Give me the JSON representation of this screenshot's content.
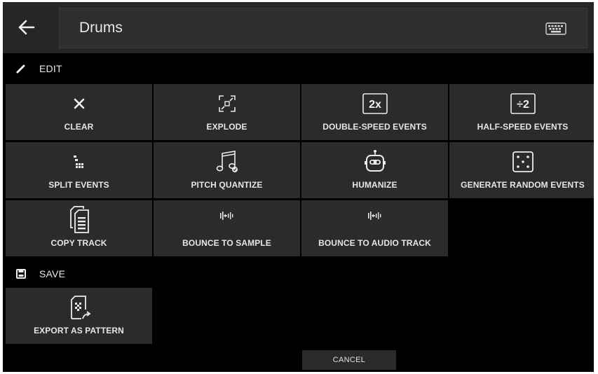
{
  "header": {
    "back_icon": "arrow-left-icon",
    "title": "Drums",
    "keyboard_icon": "keyboard-icon"
  },
  "sections": {
    "edit": {
      "label": "EDIT",
      "icon": "pencil-icon"
    },
    "save": {
      "label": "SAVE",
      "icon": "floppy-disk-icon"
    }
  },
  "edit_actions": [
    {
      "label": "CLEAR",
      "icon": "x-icon"
    },
    {
      "label": "EXPLODE",
      "icon": "explode-icon"
    },
    {
      "label": "DOUBLE-SPEED EVENTS",
      "icon": "double-speed-icon",
      "icon_text": "2x"
    },
    {
      "label": "HALF-SPEED EVENTS",
      "icon": "half-speed-icon",
      "icon_text": "÷2"
    },
    {
      "label": "SPLIT EVENTS",
      "icon": "split-events-icon"
    },
    {
      "label": "PITCH QUANTIZE",
      "icon": "music-note-icon"
    },
    {
      "label": "HUMANIZE",
      "icon": "robot-icon"
    },
    {
      "label": "GENERATE RANDOM EVENTS",
      "icon": "dice-icon"
    },
    {
      "label": "COPY TRACK",
      "icon": "copy-document-icon"
    },
    {
      "label": "BOUNCE TO SAMPLE",
      "icon": "bounce-icon"
    },
    {
      "label": "BOUNCE TO AUDIO TRACK",
      "icon": "bounce-icon"
    }
  ],
  "save_actions": [
    {
      "label": "EXPORT AS PATTERN",
      "icon": "export-pattern-icon"
    }
  ],
  "cancel_label": "CANCEL"
}
